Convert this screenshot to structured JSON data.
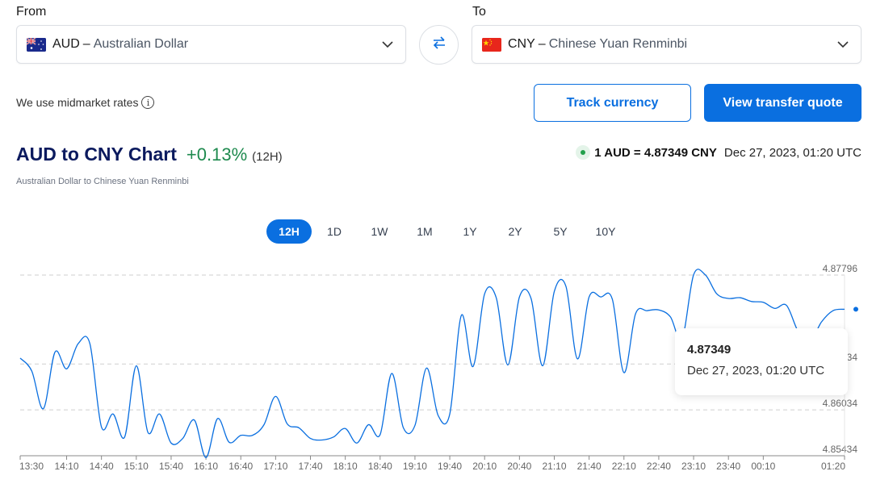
{
  "converter": {
    "from_label": "From",
    "to_label": "To",
    "from": {
      "code": "AUD",
      "separator": "–",
      "name": "Australian Dollar",
      "flag": "australia-flag"
    },
    "to": {
      "code": "CNY",
      "separator": "–",
      "name": "Chinese Yuan Renminbi",
      "flag": "china-flag"
    },
    "swap_icon": "swap-arrows-icon"
  },
  "midmarket_text": "We use midmarket rates",
  "buttons": {
    "track": "Track currency",
    "quote": "View transfer quote"
  },
  "header": {
    "title": "AUD to CNY Chart",
    "change": "+0.13%",
    "period": "(12H)",
    "subtitle": "Australian Dollar to Chinese Yuan Renminbi",
    "rate": "1 AUD = 4.87349 CNY",
    "timestamp": "Dec 27, 2023, 01:20 UTC"
  },
  "periods": [
    "12H",
    "1D",
    "1W",
    "1M",
    "1Y",
    "2Y",
    "5Y",
    "10Y"
  ],
  "active_period": "12H",
  "tooltip": {
    "value": "4.87349",
    "time": "Dec 27, 2023, 01:20 UTC"
  },
  "colors": {
    "accent": "#0a6fe0",
    "positive": "#1e8a4e",
    "title": "#0b1a5e"
  },
  "chart_data": {
    "type": "line",
    "title": "AUD to CNY Chart",
    "xlabel": "",
    "ylabel": "",
    "x_ticks": [
      "13:30",
      "14:10",
      "14:40",
      "15:10",
      "15:40",
      "16:10",
      "16:40",
      "17:10",
      "17:40",
      "18:10",
      "18:40",
      "19:10",
      "19:40",
      "20:10",
      "20:40",
      "21:10",
      "21:40",
      "22:10",
      "22:40",
      "23:10",
      "23:40",
      "00:10",
      "01:20"
    ],
    "y_ticks": [
      4.85434,
      4.86034,
      4.86634,
      4.87796
    ],
    "ylim": [
      4.85434,
      4.87796
    ],
    "grid": true,
    "x_minutes": [
      0,
      10,
      20,
      30,
      40,
      50,
      60,
      70,
      80,
      90,
      100,
      110,
      120,
      130,
      140,
      150,
      160,
      170,
      180,
      190,
      200,
      210,
      220,
      230,
      240,
      250,
      260,
      270,
      280,
      290,
      300,
      310,
      320,
      330,
      340,
      350,
      360,
      370,
      380,
      390,
      400,
      410,
      420,
      430,
      440,
      450,
      460,
      470,
      480,
      490,
      500,
      510,
      520,
      530,
      540,
      550,
      560,
      570,
      580,
      590,
      600,
      610,
      620,
      630,
      640,
      650,
      660,
      670,
      680,
      690,
      700,
      710
    ],
    "values": [
      4.8671,
      4.8654,
      4.8605,
      4.8679,
      4.8657,
      4.869,
      4.869,
      4.8581,
      4.8598,
      4.8568,
      4.8661,
      4.8574,
      4.8598,
      4.856,
      4.8566,
      4.859,
      4.8541,
      4.8592,
      4.8561,
      4.857,
      4.857,
      4.8584,
      4.8621,
      4.8585,
      4.858,
      4.8566,
      4.8564,
      4.8568,
      4.8579,
      4.856,
      4.8584,
      4.8571,
      4.8651,
      4.858,
      4.8583,
      4.8658,
      4.8596,
      4.8598,
      4.8727,
      4.866,
      4.8755,
      4.875,
      4.8662,
      4.8751,
      4.8749,
      4.8661,
      4.8758,
      4.8765,
      4.867,
      4.8751,
      4.8751,
      4.8748,
      4.8652,
      4.8729,
      4.8733,
      4.8734,
      4.8725,
      4.8696,
      4.878,
      4.878,
      4.8755,
      4.8749,
      4.875,
      4.8745,
      4.8744,
      4.8736,
      4.874,
      4.8706,
      4.8692,
      4.8718,
      4.8733,
      4.87349
    ],
    "last_point": {
      "time": "01:20",
      "value": 4.87349
    }
  }
}
